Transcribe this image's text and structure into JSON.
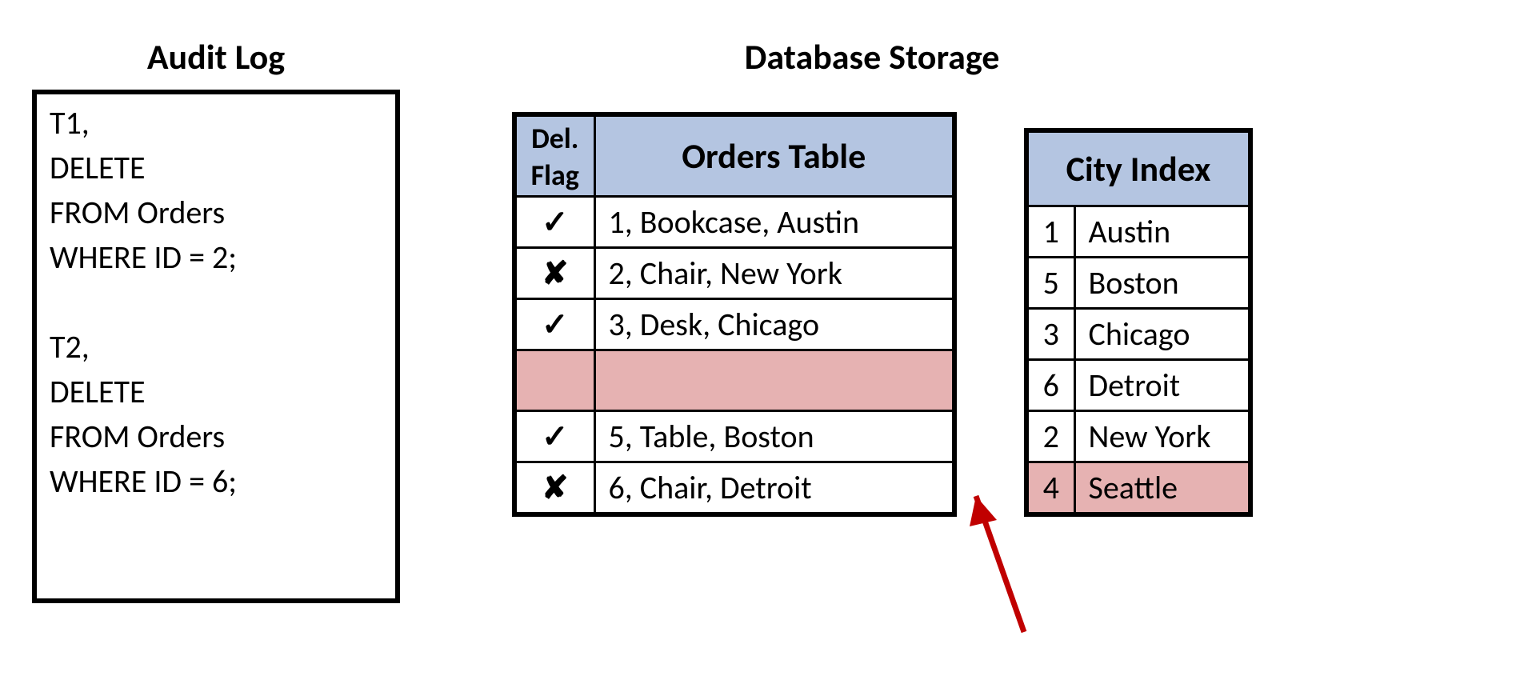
{
  "audit": {
    "title": "Audit Log",
    "lines": [
      "T1,",
      "DELETE",
      "FROM Orders",
      "WHERE ID = 2;",
      "",
      "T2,",
      "DELETE",
      "FROM Orders",
      "WHERE ID = 6;"
    ]
  },
  "storage": {
    "title": "Database Storage",
    "orders": {
      "head_flag_1": "Del.",
      "head_flag_2": "Flag",
      "head_main": "Orders Table",
      "rows": [
        {
          "flag": "✓",
          "text": "1, Bookcase, Austin",
          "empty": false
        },
        {
          "flag": "✘",
          "text": "2, Chair, New York",
          "empty": false
        },
        {
          "flag": "✓",
          "text": "3, Desk, Chicago",
          "empty": false
        },
        {
          "flag": "",
          "text": "",
          "empty": true
        },
        {
          "flag": "✓",
          "text": "5, Table, Boston",
          "empty": false
        },
        {
          "flag": "✘",
          "text": "6, Chair, Detroit",
          "empty": false
        }
      ]
    },
    "city_index": {
      "head": "City Index",
      "rows": [
        {
          "id": "1",
          "city": "Austin",
          "hl": false
        },
        {
          "id": "5",
          "city": "Boston",
          "hl": false
        },
        {
          "id": "3",
          "city": "Chicago",
          "hl": false
        },
        {
          "id": "6",
          "city": "Detroit",
          "hl": false
        },
        {
          "id": "2",
          "city": "New York",
          "hl": false
        },
        {
          "id": "4",
          "city": "Seattle",
          "hl": true
        }
      ]
    }
  },
  "icons": {
    "check": "✓",
    "cross": "✘"
  },
  "colors": {
    "header_blue": "#b4c5e1",
    "highlight_pink": "#e6b2b2",
    "arrow_red": "#c00000"
  }
}
